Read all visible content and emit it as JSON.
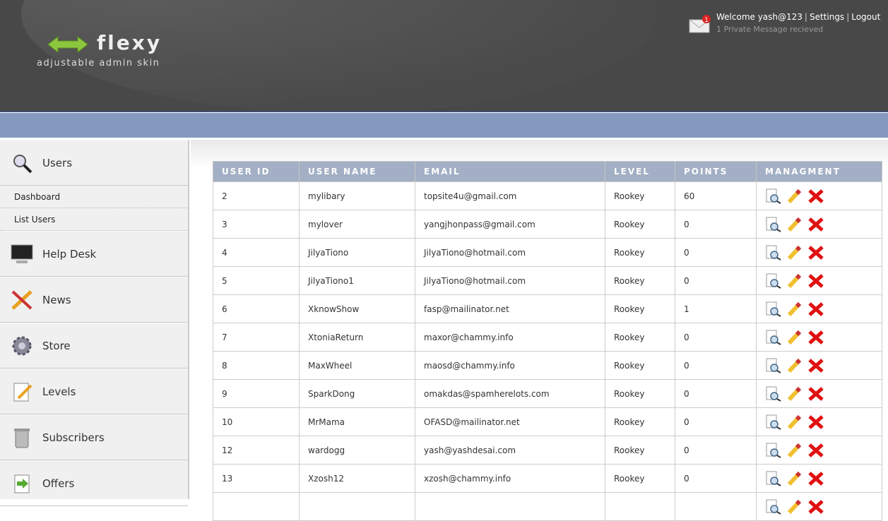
{
  "header": {
    "logo_title": "flexy",
    "logo_subtitle": "adjustable admin skin",
    "welcome": "Welcome yash@123",
    "settings": "Settings",
    "logout": "Logout",
    "message_count": "1",
    "private_message": "1 Private Message recieved"
  },
  "sidebar": {
    "users": "Users",
    "dashboard": "Dashboard",
    "list_users": "List Users",
    "help_desk": "Help Desk",
    "news": "News",
    "store": "Store",
    "levels": "Levels",
    "subscribers": "Subscribers",
    "offers": "Offers"
  },
  "table": {
    "headers": [
      "USER ID",
      "USER NAME",
      "EMAIL",
      "LEVEL",
      "POINTS",
      "MANAGMENT"
    ],
    "rows": [
      [
        "2",
        "mylibary",
        "topsite4u@gmail.com",
        "Rookey",
        "60"
      ],
      [
        "3",
        "mylover",
        "yangjhonpass@gmail.com",
        "Rookey",
        "0"
      ],
      [
        "4",
        "JilyaTiono",
        "JilyaTiono@hotmail.com",
        "Rookey",
        "0"
      ],
      [
        "5",
        "JilyaTiono1",
        "JilyaTiono@hotmail.com",
        "Rookey",
        "0"
      ],
      [
        "6",
        "XknowShow",
        "fasp@mailinator.net",
        "Rookey",
        "1"
      ],
      [
        "7",
        "XtoniaReturn",
        "maxor@chammy.info",
        "Rookey",
        "0"
      ],
      [
        "8",
        "MaxWheel",
        "maosd@chammy.info",
        "Rookey",
        "0"
      ],
      [
        "9",
        "SparkDong",
        "omakdas@spamherelots.com",
        "Rookey",
        "0"
      ],
      [
        "10",
        "MrMama",
        "OFASD@mailinator.net",
        "Rookey",
        "0"
      ],
      [
        "12",
        "wardogg",
        "yash@yashdesai.com",
        "Rookey",
        "0"
      ],
      [
        "13",
        "Xzosh12",
        "xzosh@chammy.info",
        "Rookey",
        "0"
      ],
      [
        "",
        "",
        "",
        "",
        ""
      ]
    ]
  }
}
